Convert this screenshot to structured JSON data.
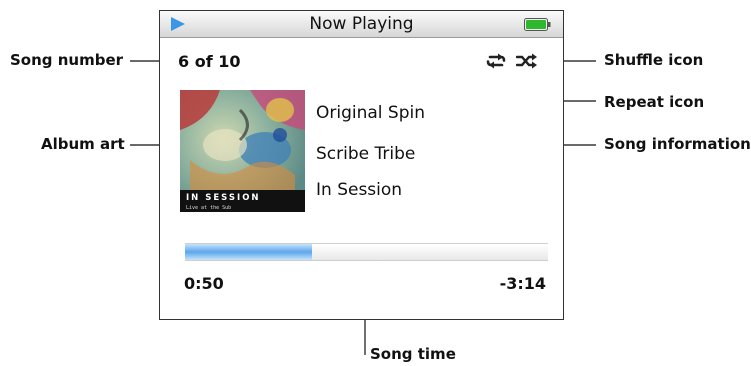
{
  "screen": {
    "title": "Now Playing",
    "icons": {
      "play": "play-icon",
      "battery": "battery-icon",
      "repeat": "repeat-icon",
      "shuffle": "shuffle-icon"
    },
    "colors": {
      "play_accent": "#3b96e6",
      "battery_fill": "#2fb82f",
      "progress_fill": "#5aa6ea"
    }
  },
  "now_playing": {
    "song_number": "6 of 10",
    "song_title": "Original Spin",
    "artist": "Scribe Tribe",
    "album": "In Session",
    "album_art_text": "IN SESSION",
    "album_art_subtext": "Live at the Sub",
    "elapsed": "0:50",
    "remaining": "-3:14",
    "progress_fraction": 0.35
  },
  "callouts": {
    "song_number": "Song number",
    "album_art": "Album art",
    "shuffle_icon": "Shuffle icon",
    "repeat_icon": "Repeat icon",
    "song_information": "Song information",
    "song_time": "Song time"
  }
}
